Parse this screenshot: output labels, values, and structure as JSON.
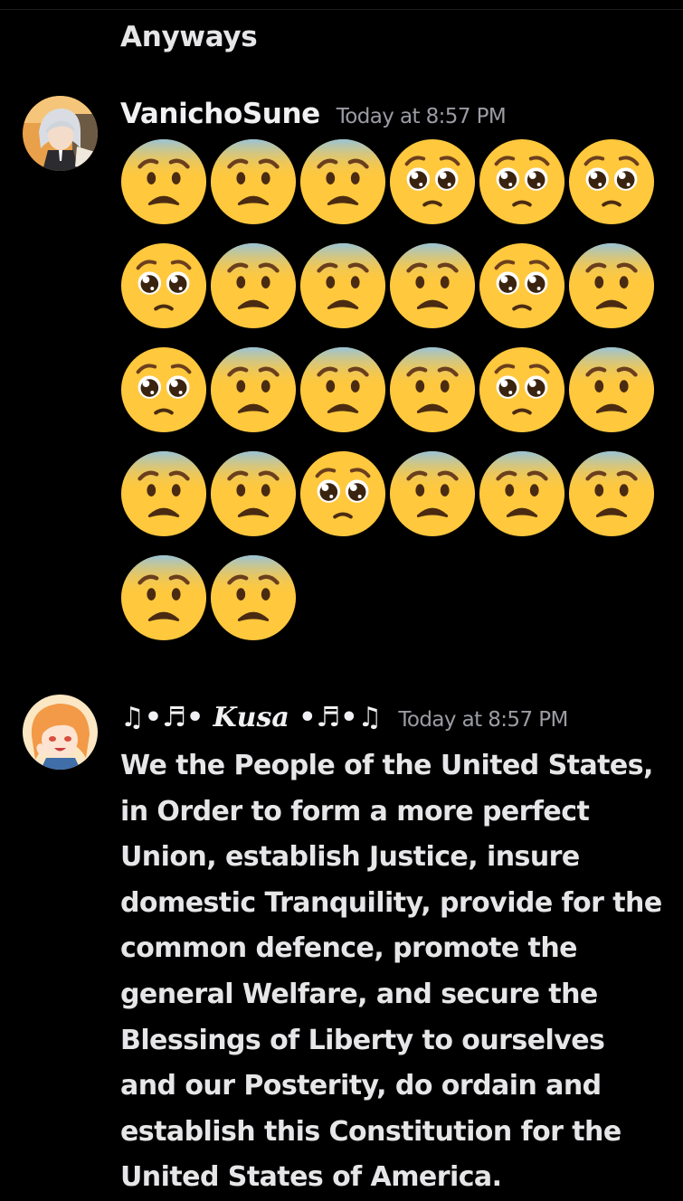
{
  "previous_message": {
    "text": "Anyways"
  },
  "messages": [
    {
      "username": "VanichoSune",
      "timestamp": "Today at 8:57 PM",
      "emojis": [
        "fearful-face",
        "fearful-face",
        "fearful-face",
        "pleading-face",
        "pleading-face",
        "pleading-face",
        "pleading-face",
        "fearful-face",
        "fearful-face",
        "fearful-face",
        "pleading-face",
        "fearful-face",
        "pleading-face",
        "fearful-face",
        "fearful-face",
        "fearful-face",
        "pleading-face",
        "fearful-face",
        "fearful-face",
        "fearful-face",
        "pleading-face",
        "fearful-face",
        "fearful-face",
        "fearful-face",
        "fearful-face",
        "fearful-face"
      ]
    },
    {
      "username": "♫•♬• 𝑲𝒖𝒔𝒂 •♬•♫",
      "timestamp": "Today at 8:57 PM",
      "text": "We the People of the United States, in Order to form a more perfect Union, establish Justice, insure domestic Tranquility, provide for the common defence, promote the general Welfare, and secure the Blessings of Liberty to ourselves and our Posterity, do ordain and establish this Constitution for the United States of America."
    }
  ],
  "colors": {
    "background": "#000000",
    "text": "#e6e6e8",
    "timestamp": "#9b9ca3",
    "emoji_yellow": "#FFC83D",
    "emoji_fear_blue": "#8fc3e8"
  }
}
